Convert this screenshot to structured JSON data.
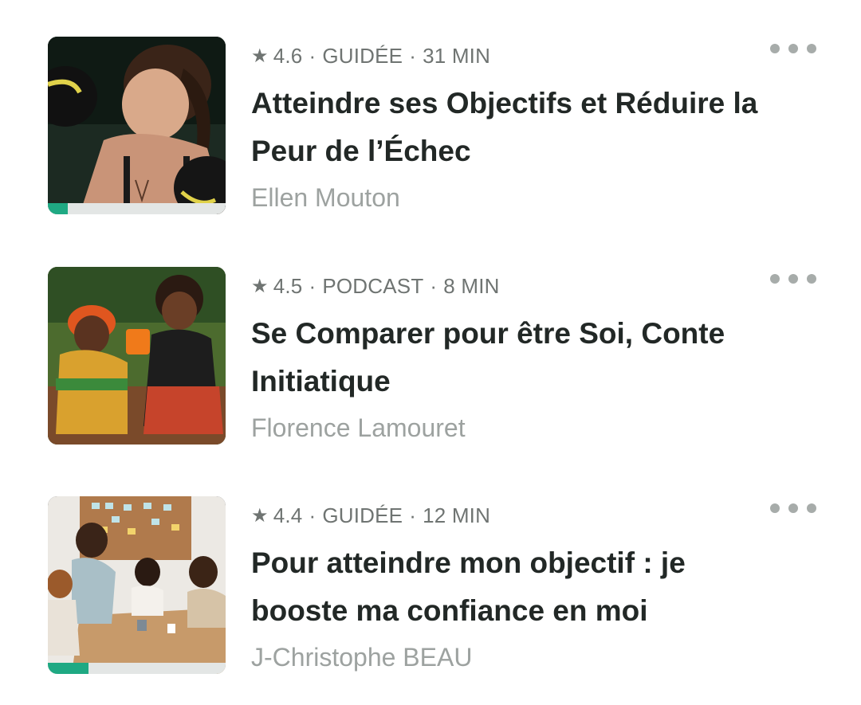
{
  "items": [
    {
      "rating": "4.6",
      "type": "GUIDÉE",
      "duration": "31 MIN",
      "title": "Atteindre ses Objectifs et Réduire la Peur de l’Échec",
      "author": "Ellen Mouton",
      "progress": 0.11,
      "image_icon": "boxing-woman-photo"
    },
    {
      "rating": "4.5",
      "type": "PODCAST",
      "duration": "8 MIN",
      "title": "Se Comparer pour être Soi, Conte Initiatique",
      "author": "Florence Lamouret",
      "progress": 0,
      "image_icon": "two-women-planting-photo"
    },
    {
      "rating": "4.4",
      "type": "GUIDÉE",
      "duration": "12 MIN",
      "title": "Pour atteindre mon objectif : je booste ma confiance en moi",
      "author": "J-Christophe BEAU",
      "progress": 0.23,
      "image_icon": "office-meeting-photo"
    }
  ],
  "colors": {
    "progress": "#1fa983",
    "title": "#222826",
    "meta": "#6f7472",
    "author": "#9da2a0"
  }
}
